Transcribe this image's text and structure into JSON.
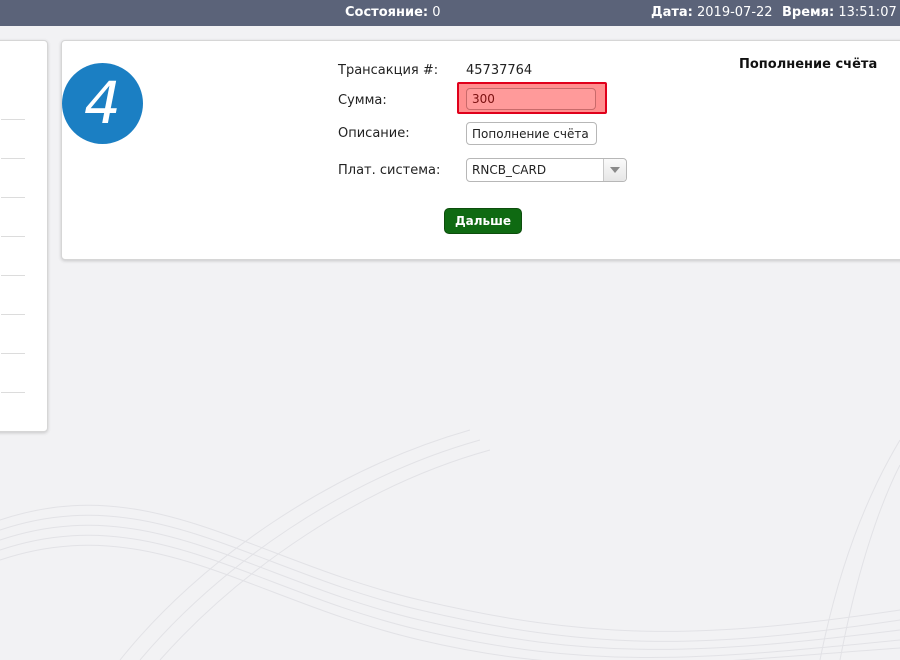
{
  "topbar": {
    "state_label": "Состояние:",
    "state_value": "0",
    "date_label": "Дата:",
    "date_value": "2019-07-22",
    "time_label": "Время:",
    "time_value": "13:51:07"
  },
  "step": {
    "number": "4"
  },
  "form": {
    "title": "Пополнение счёта",
    "transaction_label": "Трансакция #:",
    "transaction_value": "45737764",
    "amount_label": "Сумма:",
    "amount_value": "300",
    "description_label": "Описание:",
    "description_value": "Пополнение счёта",
    "system_label": "Плат. система:",
    "system_value": "RNCB_CARD",
    "next_label": "Дальше"
  },
  "colors": {
    "topbar": "#5b6379",
    "step_circle": "#1b7fc3",
    "next_button": "#0f6a12",
    "error_border": "#e0001b",
    "error_fill": "#ff8f8f"
  },
  "icons": {
    "dropdown": "chevron-down-icon"
  }
}
